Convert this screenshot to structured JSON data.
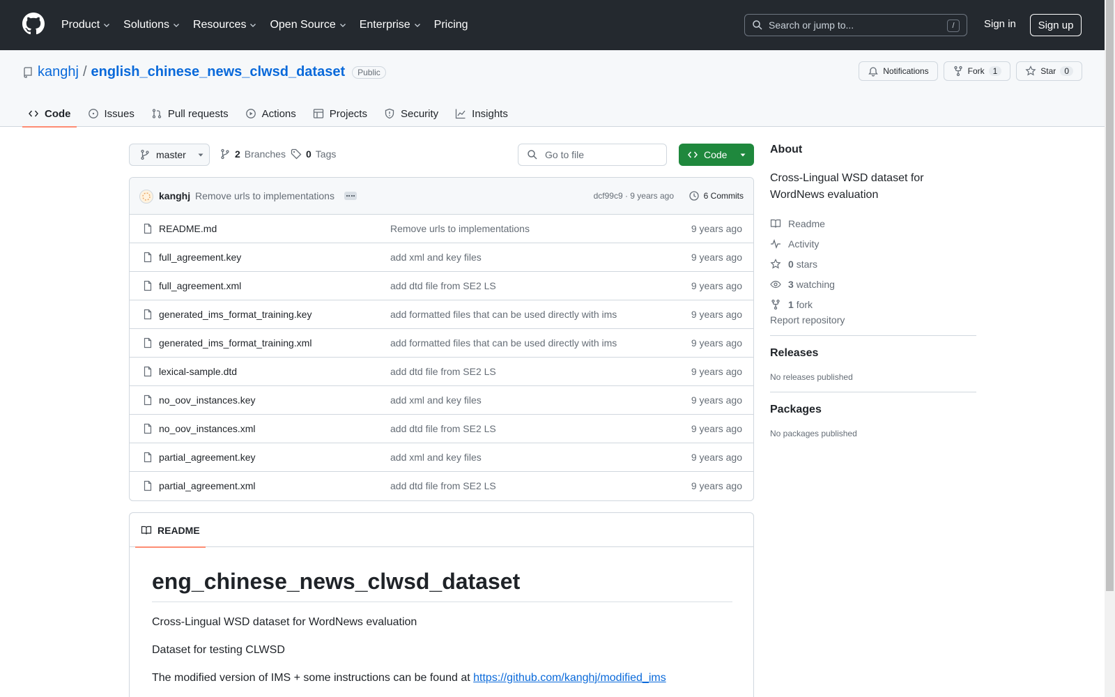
{
  "header": {
    "nav": [
      "Product",
      "Solutions",
      "Resources",
      "Open Source",
      "Enterprise",
      "Pricing"
    ],
    "search_placeholder": "Search or jump to...",
    "search_shortcut": "/",
    "signin": "Sign in",
    "signup": "Sign up"
  },
  "repo": {
    "owner": "kanghj",
    "separator": "/",
    "name": "english_chinese_news_clwsd_dataset",
    "visibility": "Public",
    "notifications": "Notifications",
    "fork_label": "Fork",
    "fork_count": "1",
    "star_label": "Star",
    "star_count": "0",
    "tabs": [
      "Code",
      "Issues",
      "Pull requests",
      "Actions",
      "Projects",
      "Security",
      "Insights"
    ]
  },
  "toolbar": {
    "branch": "master",
    "branches_count": "2",
    "branches_label": "Branches",
    "tags_count": "0",
    "tags_label": "Tags",
    "goto_file": "Go to file",
    "code_button": "Code"
  },
  "commit": {
    "author": "kanghj",
    "message": "Remove urls to implementations",
    "meta": "dcf99c9 · 9 years ago",
    "commits": "6 Commits"
  },
  "files": [
    {
      "name": "README.md",
      "message": "Remove urls to implementations",
      "age": "9 years ago"
    },
    {
      "name": "full_agreement.key",
      "message": "add xml and key files",
      "age": "9 years ago"
    },
    {
      "name": "full_agreement.xml",
      "message": "add dtd file from SE2 LS",
      "age": "9 years ago"
    },
    {
      "name": "generated_ims_format_training.key",
      "message": "add formatted files that can be used directly with ims",
      "age": "9 years ago"
    },
    {
      "name": "generated_ims_format_training.xml",
      "message": "add formatted files that can be used directly with ims",
      "age": "9 years ago"
    },
    {
      "name": "lexical-sample.dtd",
      "message": "add dtd file from SE2 LS",
      "age": "9 years ago"
    },
    {
      "name": "no_oov_instances.key",
      "message": "add xml and key files",
      "age": "9 years ago"
    },
    {
      "name": "no_oov_instances.xml",
      "message": "add dtd file from SE2 LS",
      "age": "9 years ago"
    },
    {
      "name": "partial_agreement.key",
      "message": "add xml and key files",
      "age": "9 years ago"
    },
    {
      "name": "partial_agreement.xml",
      "message": "add dtd file from SE2 LS",
      "age": "9 years ago"
    }
  ],
  "readme": {
    "tab": "README",
    "heading": "eng_chinese_news_clwsd_dataset",
    "p1": "Cross-Lingual WSD dataset for WordNews evaluation",
    "p2": "Dataset for testing CLWSD",
    "p3_text": "The modified version of IMS + some instructions can be found at ",
    "p3_link": "https://github.com/kanghj/modified_ims"
  },
  "sidebar": {
    "about_title": "About",
    "description": "Cross-Lingual WSD dataset for WordNews evaluation",
    "readme": "Readme",
    "activity": "Activity",
    "stars_count": "0",
    "stars_label": "stars",
    "watching_count": "3",
    "watching_label": "watching",
    "forks_count": "1",
    "forks_label": "fork",
    "report": "Report repository",
    "releases_title": "Releases",
    "releases_text": "No releases published",
    "packages_title": "Packages",
    "packages_text": "No packages published"
  },
  "colors": {
    "header_bg": "#24292f",
    "link": "#0969da",
    "primary_button": "#1f883d",
    "tab_underline": "#fd8c73"
  }
}
